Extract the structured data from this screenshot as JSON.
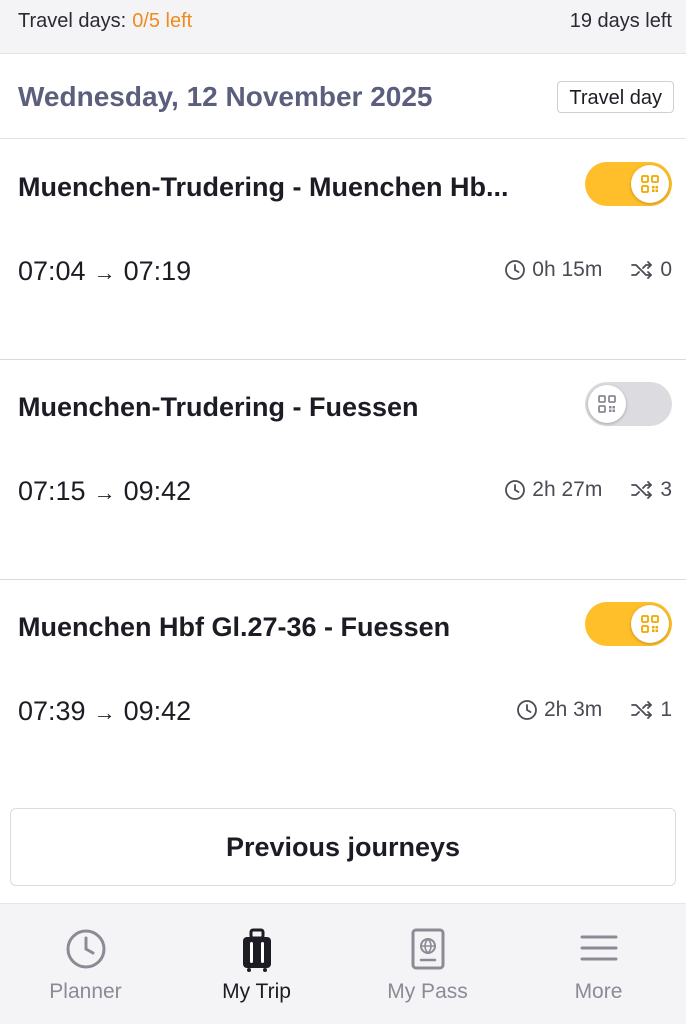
{
  "status": {
    "travel_days_label": "Travel days:",
    "travel_days_value": "0/5 left",
    "days_left": "19 days left"
  },
  "date_header": {
    "date": "Wednesday, 12 November 2025",
    "badge": "Travel day"
  },
  "journeys": [
    {
      "route": "Muenchen-Trudering - Muenchen Hb...",
      "depart": "07:04",
      "arrive": "07:19",
      "duration": "0h 15m",
      "changes": "0",
      "enabled": true
    },
    {
      "route": "Muenchen-Trudering - Fuessen",
      "depart": "07:15",
      "arrive": "09:42",
      "duration": "2h 27m",
      "changes": "3",
      "enabled": false
    },
    {
      "route": "Muenchen Hbf Gl.27-36 - Fuessen",
      "depart": "07:39",
      "arrive": "09:42",
      "duration": "2h 3m",
      "changes": "1",
      "enabled": true
    }
  ],
  "previous_button": "Previous journeys",
  "tabs": [
    {
      "label": "Planner",
      "icon": "clock-icon",
      "active": false
    },
    {
      "label": "My Trip",
      "icon": "suitcase-icon",
      "active": true
    },
    {
      "label": "My Pass",
      "icon": "passport-icon",
      "active": false
    },
    {
      "label": "More",
      "icon": "menu-icon",
      "active": false
    }
  ],
  "colors": {
    "accent_orange": "#f08a1d",
    "toggle_on": "#ffbf2a",
    "date_text": "#5b5f7d"
  }
}
